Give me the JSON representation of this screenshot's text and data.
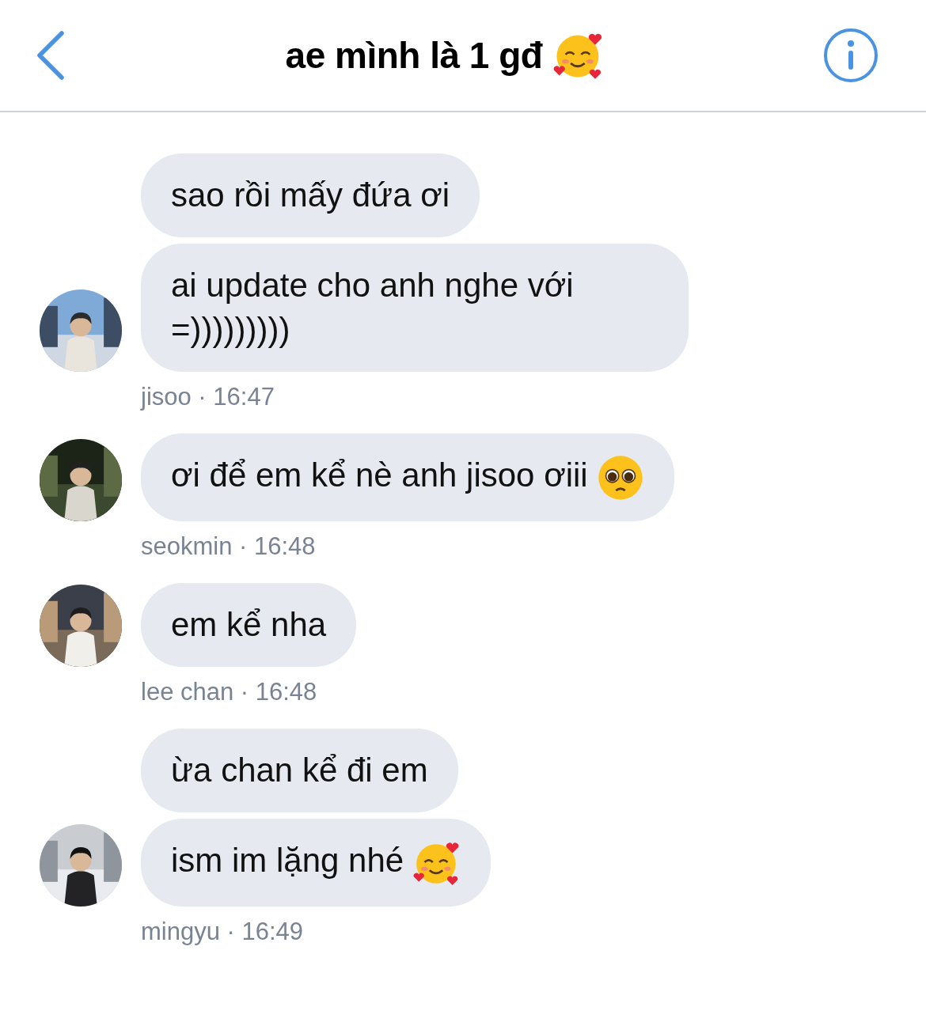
{
  "header": {
    "title": "ae mình là 1 gđ"
  },
  "groups": [
    {
      "meta": "jisoo · 16:47",
      "avatar": {
        "kind": "picture"
      },
      "messages": [
        {
          "text": "sao rồi mấy đứa ơi",
          "kind": "plain"
        },
        {
          "text": "ai update cho anh nghe với =)))))))))",
          "kind": "plain"
        }
      ]
    },
    {
      "meta": "seokmin · 16:48",
      "avatar": {
        "kind": "picture"
      },
      "messages": [
        {
          "text": "ơi để em kể nè anh jisoo ơiii",
          "kind": "pleading"
        }
      ]
    },
    {
      "meta": "lee chan · 16:48",
      "avatar": {
        "kind": "picture"
      },
      "messages": [
        {
          "text": "em kể nha",
          "kind": "plain"
        }
      ]
    },
    {
      "meta": "mingyu · 16:49",
      "avatar": {
        "kind": "picture"
      },
      "messages": [
        {
          "text": "ừa chan kể đi em",
          "kind": "plain"
        },
        {
          "text": "ism im lặng nhé",
          "kind": "hearts"
        }
      ]
    }
  ]
}
